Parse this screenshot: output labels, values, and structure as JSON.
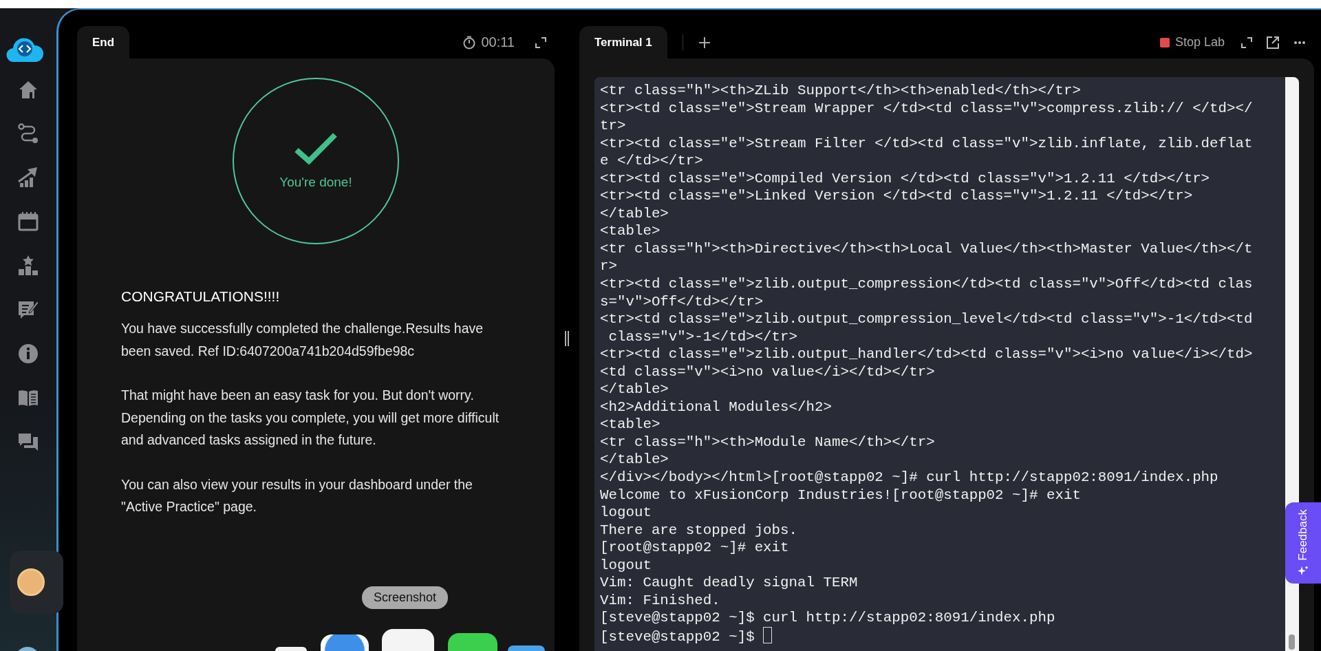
{
  "left_panel": {
    "tab": {
      "label": "End",
      "selected": true
    },
    "timer": "00:11",
    "result": {
      "status": "You're done!",
      "heading": "CONGRATULATIONS!!!!",
      "paragraphs": [
        "You have successfully completed the challenge.Results have been saved. Ref ID:6407200a741b204d59fbe98c",
        "That might have been an easy task for you. But don't worry. Depending on the tasks you complete, you will get more difficult and advanced tasks assigned in the future.",
        "You can also view your results in your dashboard under the \"Active Practice\" page."
      ]
    }
  },
  "right_panel": {
    "tabs": [
      {
        "label": "Terminal 1",
        "selected": true
      }
    ],
    "stop_button": "Stop Lab",
    "terminal": {
      "cursor": true,
      "lines": [
        "<tr class=\"h\"><th>ZLib Support</th><th>enabled</th></tr>",
        "<tr><td class=\"e\">Stream Wrapper </td><td class=\"v\">compress.zlib:// </td></",
        "tr>",
        "<tr><td class=\"e\">Stream Filter </td><td class=\"v\">zlib.inflate, zlib.deflat",
        "e </td></tr>",
        "<tr><td class=\"e\">Compiled Version </td><td class=\"v\">1.2.11 </td></tr>",
        "<tr><td class=\"e\">Linked Version </td><td class=\"v\">1.2.11 </td></tr>",
        "</table>",
        "<table>",
        "<tr class=\"h\"><th>Directive</th><th>Local Value</th><th>Master Value</th></t",
        "r>",
        "<tr><td class=\"e\">zlib.output_compression</td><td class=\"v\">Off</td><td clas",
        "s=\"v\">Off</td></tr>",
        "<tr><td class=\"e\">zlib.output_compression_level</td><td class=\"v\">-1</td><td",
        " class=\"v\">-1</td></tr>",
        "<tr><td class=\"e\">zlib.output_handler</td><td class=\"v\"><i>no value</i></td>",
        "<td class=\"v\"><i>no value</i></td></tr>",
        "</table>",
        "<h2>Additional Modules</h2>",
        "<table>",
        "<tr class=\"h\"><th>Module Name</th></tr>",
        "</table>",
        "</div></body></html>[root@stapp02 ~]# curl http://stapp02:8091/index.php",
        "Welcome to xFusionCorp Industries![root@stapp02 ~]# exit",
        "logout",
        "There are stopped jobs.",
        "[root@stapp02 ~]# exit",
        "logout",
        "Vim: Caught deadly signal TERM",
        "Vim: Finished.",
        "[steve@stapp02 ~]$ curl http://stapp02:8091/index.php",
        "[steve@stapp02 ~]$"
      ]
    }
  },
  "feedback": "Feedback",
  "dock": {
    "tooltip": "Screenshot"
  }
}
